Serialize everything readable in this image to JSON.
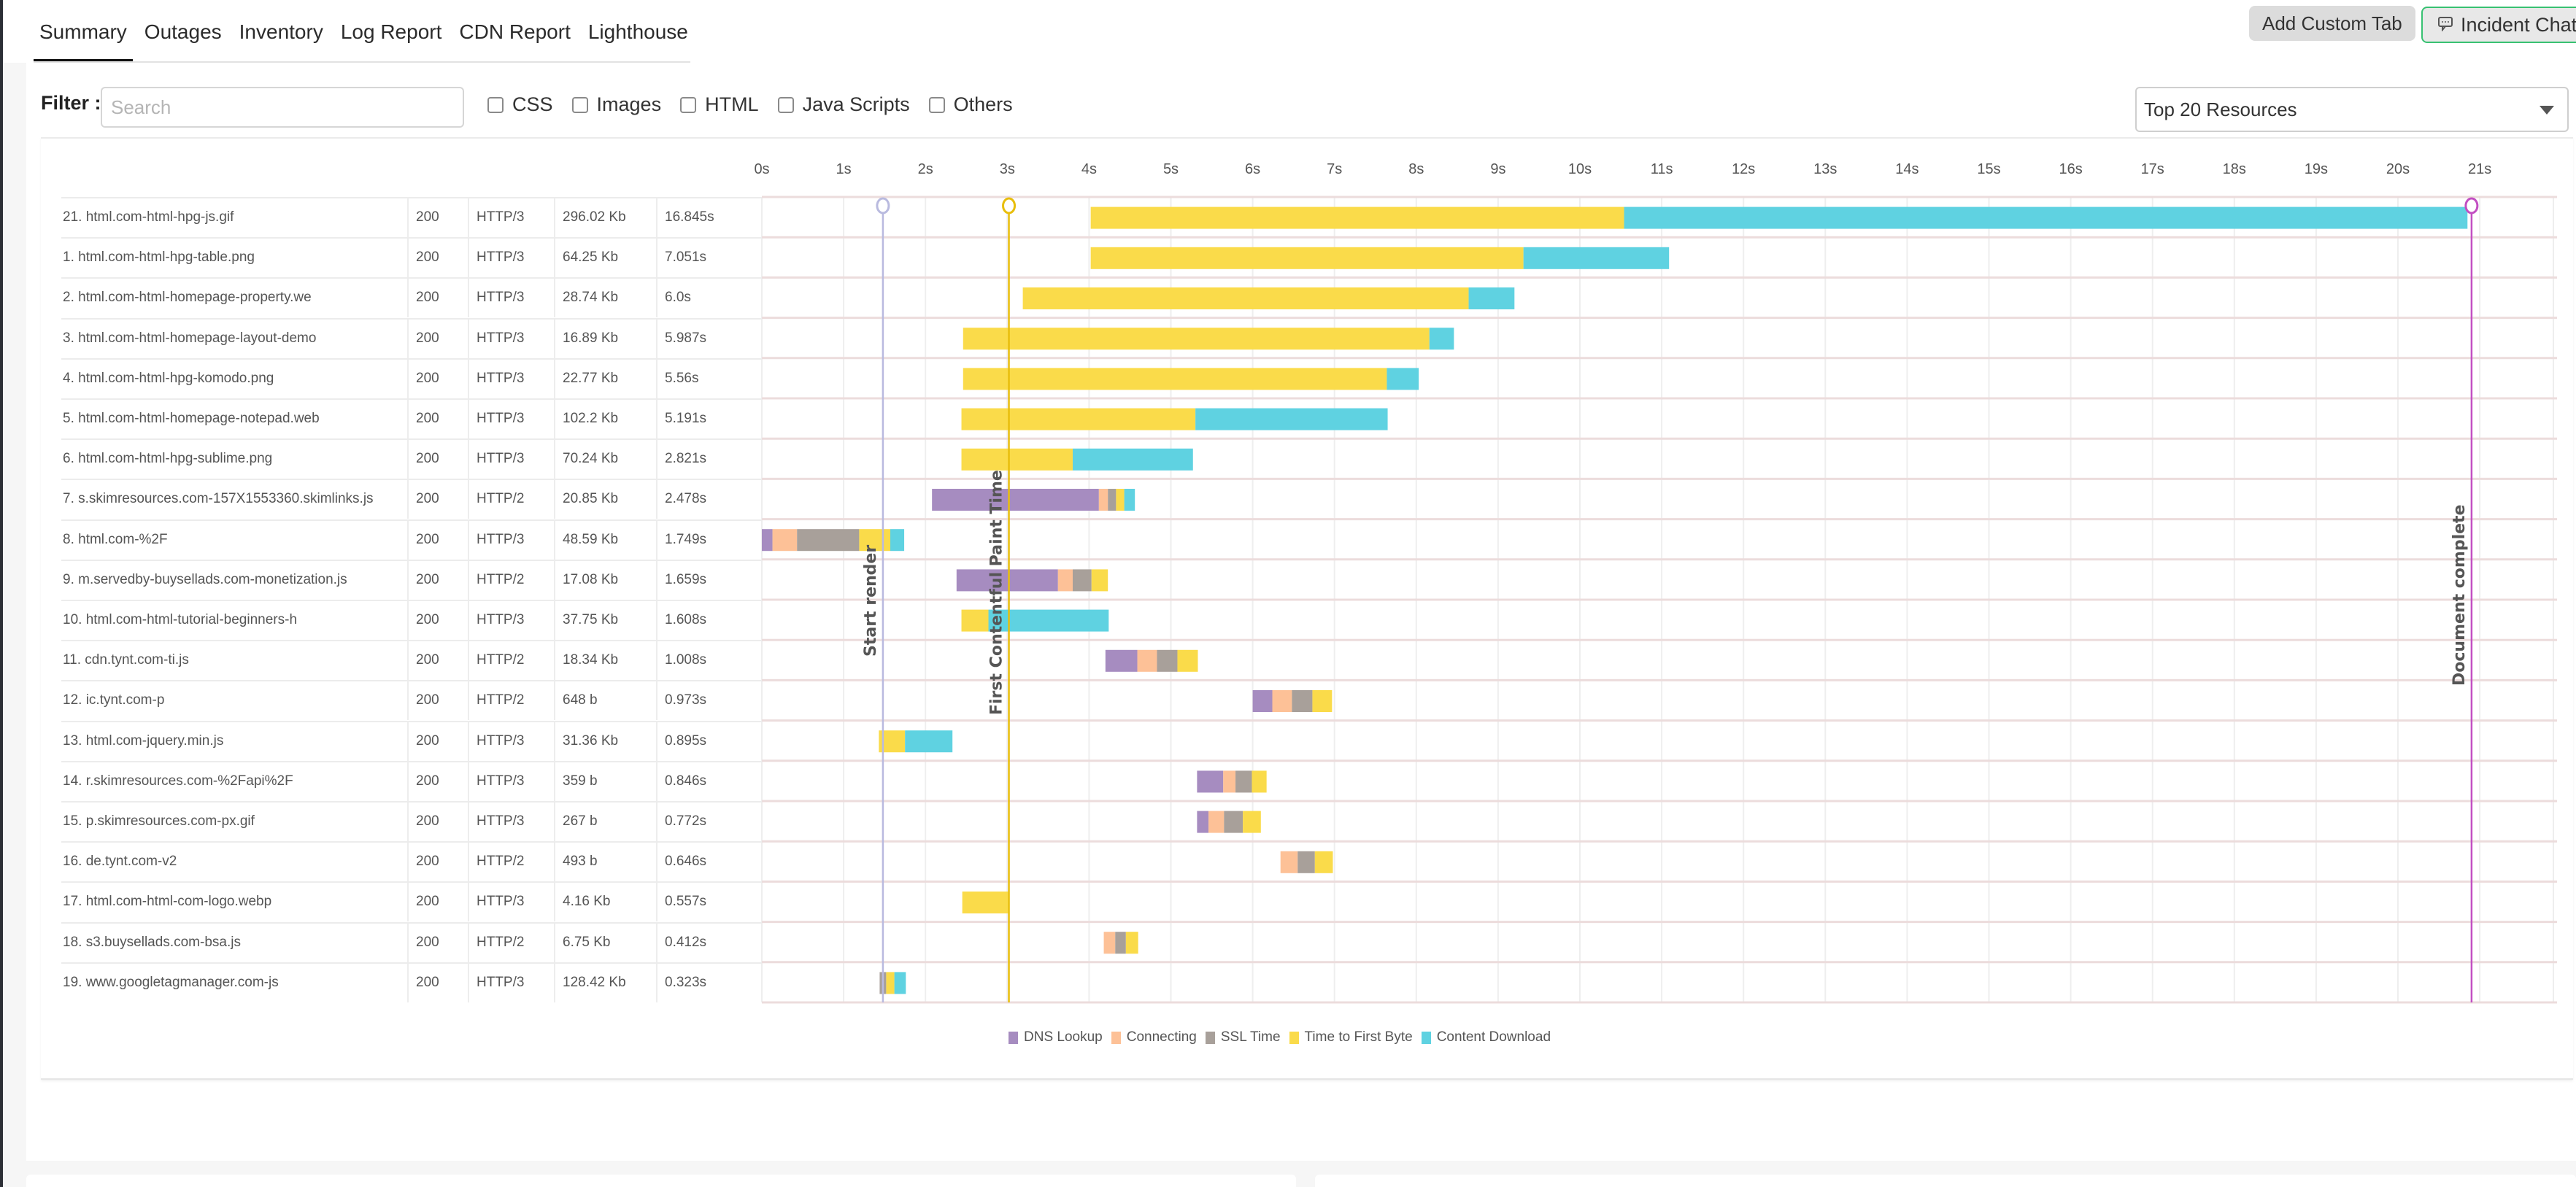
{
  "tabs": [
    {
      "label": "Summary",
      "active": true
    },
    {
      "label": "Outages",
      "active": false
    },
    {
      "label": "Inventory",
      "active": false
    },
    {
      "label": "Log Report",
      "active": false
    },
    {
      "label": "CDN Report",
      "active": false
    },
    {
      "label": "Lighthouse",
      "active": false
    }
  ],
  "header": {
    "add_custom_tab_label": "Add Custom Tab",
    "incident_chat_label": "Incident Chat",
    "incident_chat_icon": "chat-bubble-icon"
  },
  "filter": {
    "label": "Filter :",
    "search_placeholder": "Search",
    "search_value": "",
    "checkboxes": [
      {
        "label": "CSS",
        "checked": false
      },
      {
        "label": "Images",
        "checked": false
      },
      {
        "label": "HTML",
        "checked": false
      },
      {
        "label": "Java Scripts",
        "checked": false
      },
      {
        "label": "Others",
        "checked": false
      }
    ],
    "resource_select": {
      "selected": "Top 20 Resources",
      "icon": "caret-down-icon"
    }
  },
  "colors": {
    "dns": "#a68cc0",
    "connecting": "#fdc197",
    "ssl": "#a8a09a",
    "ttfb": "#fadb4a",
    "download": "#5fd2e1",
    "start_render": "#b9badf",
    "fcp": "#e8be0c",
    "doc_complete": "#c24fc2",
    "row_line": "#ecdcdc"
  },
  "chart_data": {
    "type": "waterfall",
    "title": "",
    "xlabel": "",
    "ylabel": "",
    "x_unit": "s",
    "xlim": [
      0,
      21
    ],
    "x_ticks": [
      "0s",
      "1s",
      "2s",
      "3s",
      "4s",
      "5s",
      "6s",
      "7s",
      "8s",
      "9s",
      "10s",
      "11s",
      "12s",
      "13s",
      "14s",
      "15s",
      "16s",
      "17s",
      "18s",
      "19s",
      "20s",
      "21s"
    ],
    "legend": [
      {
        "key": "dns",
        "label": "DNS Lookup"
      },
      {
        "key": "connecting",
        "label": "Connecting"
      },
      {
        "key": "ssl",
        "label": "SSL Time"
      },
      {
        "key": "ttfb",
        "label": "Time to First Byte"
      },
      {
        "key": "download",
        "label": "Content Download"
      }
    ],
    "legend_position": "bottom-center",
    "markers": [
      {
        "label": "Start render",
        "time": 1.48,
        "color_key": "start_render"
      },
      {
        "label": "First Contentful Paint Time",
        "time": 3.02,
        "color_key": "fcp"
      },
      {
        "label": "Document complete",
        "time": 20.9,
        "color_key": "doc_complete"
      }
    ],
    "rows": [
      {
        "name": "21. html.com-html-hpg-js.gif",
        "status": "200",
        "protocol": "HTTP/3",
        "size": "296.02 Kb",
        "time": "16.845s",
        "start": 4.02,
        "segments": [
          [
            "ttfb",
            6.52
          ],
          [
            "download",
            10.31
          ]
        ]
      },
      {
        "name": "1. html.com-html-hpg-table.png",
        "status": "200",
        "protocol": "HTTP/3",
        "size": "64.25 Kb",
        "time": "7.051s",
        "start": 4.02,
        "segments": [
          [
            "ttfb",
            5.29
          ],
          [
            "download",
            1.78
          ]
        ]
      },
      {
        "name": "2. html.com-html-homepage-property.we",
        "status": "200",
        "protocol": "HTTP/3",
        "size": "28.74 Kb",
        "time": "6.0s",
        "start": 3.19,
        "segments": [
          [
            "ttfb",
            5.45
          ],
          [
            "download",
            0.56
          ]
        ]
      },
      {
        "name": "3. html.com-html-homepage-layout-demo",
        "status": "200",
        "protocol": "HTTP/3",
        "size": "16.89 Kb",
        "time": "5.987s",
        "start": 2.46,
        "segments": [
          [
            "ttfb",
            5.7
          ],
          [
            "download",
            0.3
          ]
        ]
      },
      {
        "name": "4. html.com-html-hpg-komodo.png",
        "status": "200",
        "protocol": "HTTP/3",
        "size": "22.77 Kb",
        "time": "5.56s",
        "start": 2.46,
        "segments": [
          [
            "ttfb",
            5.18
          ],
          [
            "download",
            0.39
          ]
        ]
      },
      {
        "name": "5. html.com-html-homepage-notepad.web",
        "status": "200",
        "protocol": "HTTP/3",
        "size": "102.2 Kb",
        "time": "5.191s",
        "start": 2.44,
        "segments": [
          [
            "ttfb",
            2.86
          ],
          [
            "download",
            2.35
          ]
        ]
      },
      {
        "name": "6. html.com-html-hpg-sublime.png",
        "status": "200",
        "protocol": "HTTP/3",
        "size": "70.24 Kb",
        "time": "2.821s",
        "start": 2.44,
        "segments": [
          [
            "ttfb",
            1.36
          ],
          [
            "download",
            1.47
          ]
        ]
      },
      {
        "name": "7. s.skimresources.com-157X1553360.skimlinks.js",
        "status": "200",
        "protocol": "HTTP/2",
        "size": "20.85 Kb",
        "time": "2.478s",
        "start": 2.08,
        "segments": [
          [
            "dns",
            2.04
          ],
          [
            "connecting",
            0.11
          ],
          [
            "ssl",
            0.1
          ],
          [
            "ttfb",
            0.1
          ],
          [
            "download",
            0.13
          ]
        ]
      },
      {
        "name": "8. html.com-%2F",
        "status": "200",
        "protocol": "HTTP/3",
        "size": "48.59 Kb",
        "time": "1.749s",
        "start": 0.0,
        "segments": [
          [
            "dns",
            0.13
          ],
          [
            "connecting",
            0.3
          ],
          [
            "ssl",
            0.76
          ],
          [
            "ttfb",
            0.38
          ],
          [
            "download",
            0.17
          ]
        ]
      },
      {
        "name": "9. m.servedby-buysellads.com-monetization.js",
        "status": "200",
        "protocol": "HTTP/2",
        "size": "17.08 Kb",
        "time": "1.659s",
        "start": 2.38,
        "segments": [
          [
            "dns",
            1.24
          ],
          [
            "connecting",
            0.18
          ],
          [
            "ssl",
            0.23
          ],
          [
            "ttfb",
            0.2
          ]
        ]
      },
      {
        "name": "10. html.com-html-tutorial-beginners-h",
        "status": "200",
        "protocol": "HTTP/3",
        "size": "37.75 Kb",
        "time": "1.608s",
        "start": 2.44,
        "segments": [
          [
            "ttfb",
            0.33
          ],
          [
            "download",
            1.47
          ]
        ]
      },
      {
        "name": "11. cdn.tynt.com-ti.js",
        "status": "200",
        "protocol": "HTTP/2",
        "size": "18.34 Kb",
        "time": "1.008s",
        "start": 4.2,
        "segments": [
          [
            "dns",
            0.39
          ],
          [
            "connecting",
            0.24
          ],
          [
            "ssl",
            0.25
          ],
          [
            "ttfb",
            0.25
          ]
        ]
      },
      {
        "name": "12. ic.tynt.com-p",
        "status": "200",
        "protocol": "HTTP/2",
        "size": "648 b",
        "time": "0.973s",
        "start": 6.0,
        "segments": [
          [
            "dns",
            0.24
          ],
          [
            "connecting",
            0.24
          ],
          [
            "ssl",
            0.25
          ],
          [
            "ttfb",
            0.24
          ]
        ]
      },
      {
        "name": "13. html.com-jquery.min.js",
        "status": "200",
        "protocol": "HTTP/3",
        "size": "31.36 Kb",
        "time": "0.895s",
        "start": 1.43,
        "segments": [
          [
            "ttfb",
            0.32
          ],
          [
            "download",
            0.58
          ]
        ]
      },
      {
        "name": "14. r.skimresources.com-%2Fapi%2F",
        "status": "200",
        "protocol": "HTTP/3",
        "size": "359 b",
        "time": "0.846s",
        "start": 5.32,
        "segments": [
          [
            "dns",
            0.32
          ],
          [
            "connecting",
            0.15
          ],
          [
            "ssl",
            0.2
          ],
          [
            "ttfb",
            0.18
          ]
        ]
      },
      {
        "name": "15. p.skimresources.com-px.gif",
        "status": "200",
        "protocol": "HTTP/3",
        "size": "267 b",
        "time": "0.772s",
        "start": 5.32,
        "segments": [
          [
            "dns",
            0.14
          ],
          [
            "connecting",
            0.19
          ],
          [
            "ssl",
            0.23
          ],
          [
            "ttfb",
            0.22
          ]
        ]
      },
      {
        "name": "16. de.tynt.com-v2",
        "status": "200",
        "protocol": "HTTP/2",
        "size": "493 b",
        "time": "0.646s",
        "start": 6.34,
        "segments": [
          [
            "connecting",
            0.21
          ],
          [
            "ssl",
            0.21
          ],
          [
            "ttfb",
            0.22
          ]
        ]
      },
      {
        "name": "17. html.com-html-com-logo.webp",
        "status": "200",
        "protocol": "HTTP/3",
        "size": "4.16 Kb",
        "time": "0.557s",
        "start": 2.45,
        "segments": [
          [
            "ttfb",
            0.56
          ]
        ]
      },
      {
        "name": "18. s3.buysellads.com-bsa.js",
        "status": "200",
        "protocol": "HTTP/2",
        "size": "6.75 Kb",
        "time": "0.412s",
        "start": 4.18,
        "segments": [
          [
            "connecting",
            0.14
          ],
          [
            "ssl",
            0.13
          ],
          [
            "ttfb",
            0.15
          ]
        ]
      },
      {
        "name": "19. www.googletagmanager.com-js",
        "status": "200",
        "protocol": "HTTP/3",
        "size": "128.42 Kb",
        "time": "0.323s",
        "start": 1.44,
        "segments": [
          [
            "ssl",
            0.08
          ],
          [
            "ttfb",
            0.1
          ],
          [
            "download",
            0.14
          ]
        ]
      }
    ]
  }
}
